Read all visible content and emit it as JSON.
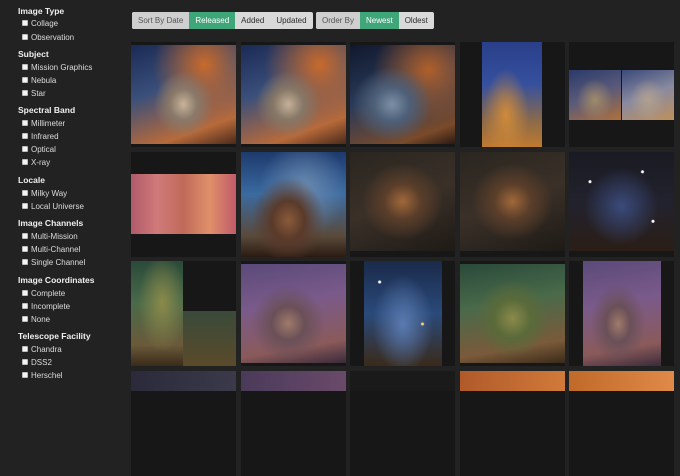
{
  "sidebar": {
    "sections": [
      {
        "title": "Image Type",
        "options": [
          "Collage",
          "Observation"
        ]
      },
      {
        "title": "Subject",
        "options": [
          "Mission Graphics",
          "Nebula",
          "Star"
        ]
      },
      {
        "title": "Spectral Band",
        "options": [
          "Millimeter",
          "Infrared",
          "Optical",
          "X-ray"
        ]
      },
      {
        "title": "Locale",
        "options": [
          "Milky Way",
          "Local Universe"
        ]
      },
      {
        "title": "Image Channels",
        "options": [
          "Multi-Mission",
          "Multi-Channel",
          "Single Channel"
        ]
      },
      {
        "title": "Image Coordinates",
        "options": [
          "Complete",
          "Incomplete",
          "None"
        ]
      },
      {
        "title": "Telescope Facility",
        "options": [
          "Chandra",
          "DSS2",
          "Herschel"
        ]
      }
    ]
  },
  "toolbar": {
    "sort_label": "Sort By Date",
    "sort_options": [
      "Released",
      "Added",
      "Updated"
    ],
    "sort_active": "Released",
    "order_label": "Order By",
    "order_options": [
      "Newest",
      "Oldest"
    ],
    "order_active": "Newest"
  },
  "colors": {
    "accent": "#3fa679",
    "page_background": "#222222",
    "tile_background": "#171717"
  }
}
